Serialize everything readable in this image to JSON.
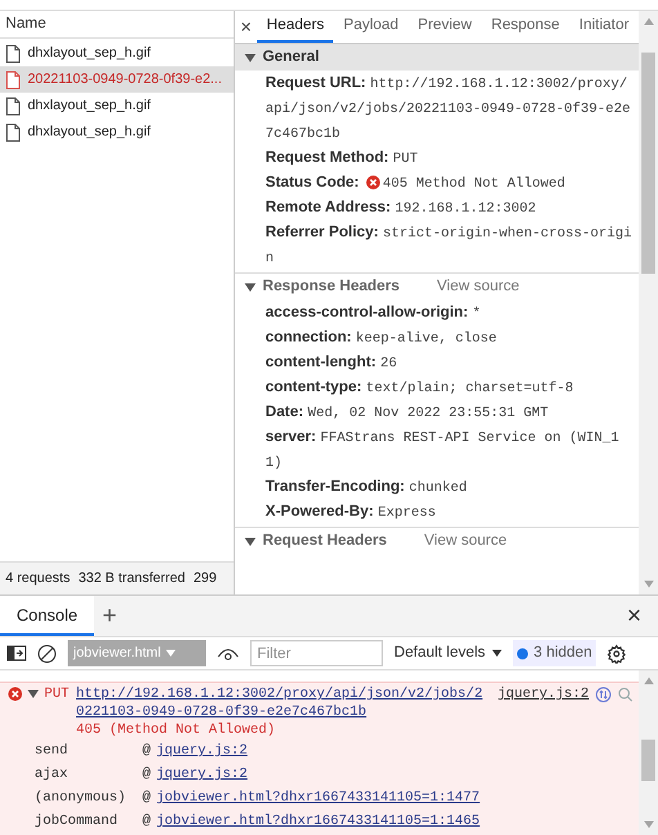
{
  "network": {
    "column": "Name",
    "requests": [
      {
        "name": "dhxlayout_sep_h.gif",
        "selected": false,
        "failed": false
      },
      {
        "name": "20221103-0949-0728-0f39-e2...",
        "selected": true,
        "failed": true
      },
      {
        "name": "dhxlayout_sep_h.gif",
        "selected": false,
        "failed": false
      },
      {
        "name": "dhxlayout_sep_h.gif",
        "selected": false,
        "failed": false
      }
    ],
    "summary": [
      "4 requests",
      "332 B transferred",
      "299"
    ]
  },
  "details": {
    "close": "×",
    "tabs": [
      {
        "label": "Headers",
        "selected": true
      },
      {
        "label": "Payload",
        "selected": false
      },
      {
        "label": "Preview",
        "selected": false
      },
      {
        "label": "Response",
        "selected": false
      },
      {
        "label": "Initiator",
        "selected": false
      }
    ],
    "sections": [
      {
        "title": "General",
        "expanded": true,
        "highlighted": true,
        "rows": [
          {
            "key": "Request URL:",
            "value": "http://192.168.1.12:3002/proxy/api/json/v2/jobs/20221103-0949-0728-0f39-e2e7c467bc1b",
            "error": false
          },
          {
            "key": "Request Method:",
            "value": "PUT",
            "error": false
          },
          {
            "key": "Status Code:",
            "value": "405 Method Not Allowed",
            "error": true
          },
          {
            "key": "Remote Address:",
            "value": "192.168.1.12:3002",
            "error": false
          },
          {
            "key": "Referrer Policy:",
            "value": "strict-origin-when-cross-origin",
            "error": false
          }
        ]
      },
      {
        "title": "Response Headers",
        "view_source": "View source",
        "expanded": true,
        "highlighted": false,
        "rows": [
          {
            "key": "access-control-allow-origin:",
            "value": "*",
            "error": false
          },
          {
            "key": "connection:",
            "value": "keep-alive, close",
            "error": false
          },
          {
            "key": "content-lenght:",
            "value": "26",
            "error": false
          },
          {
            "key": "content-type:",
            "value": "text/plain; charset=utf-8",
            "error": false
          },
          {
            "key": "Date:",
            "value": "Wed, 02 Nov 2022 23:55:31 GMT",
            "error": false
          },
          {
            "key": "server:",
            "value": "FFAStrans REST-API Service on (WIN_11)",
            "error": false
          },
          {
            "key": "Transfer-Encoding:",
            "value": "chunked",
            "error": false
          },
          {
            "key": "X-Powered-By:",
            "value": "Express",
            "error": false
          }
        ]
      },
      {
        "title": "Request Headers",
        "view_source": "View source",
        "expanded": true,
        "highlighted": false
      }
    ]
  },
  "drawer": {
    "tabs": [
      {
        "label": "Console",
        "selected": true
      }
    ],
    "add": "+",
    "close": "×",
    "toolbar": {
      "context": "jobviewer.html",
      "context_disabled": true,
      "filter_placeholder": "Filter",
      "levels": "Default levels",
      "hidden": "3 hidden"
    },
    "messages": [
      {
        "kind": "error",
        "expanded": true,
        "method": "PUT",
        "url": "http://192.168.1.12:3002/proxy/api/json/v2/jobs/20221103-0949-0728-0f39-e2e7c467bc1b",
        "status": "405 (Method Not Allowed)",
        "source": "jquery.js:2",
        "stack": [
          {
            "function": "send",
            "at": "@",
            "location": "jquery.js:2"
          },
          {
            "function": "ajax",
            "at": "@",
            "location": "jquery.js:2"
          },
          {
            "function": "(anonymous)",
            "at": "@",
            "location": "jobviewer.html?dhxr1667433141105=1:1477"
          },
          {
            "function": "jobCommand",
            "at": "@",
            "location": "jobviewer.html?dhxr1667433141105=1:1465"
          }
        ]
      }
    ]
  }
}
